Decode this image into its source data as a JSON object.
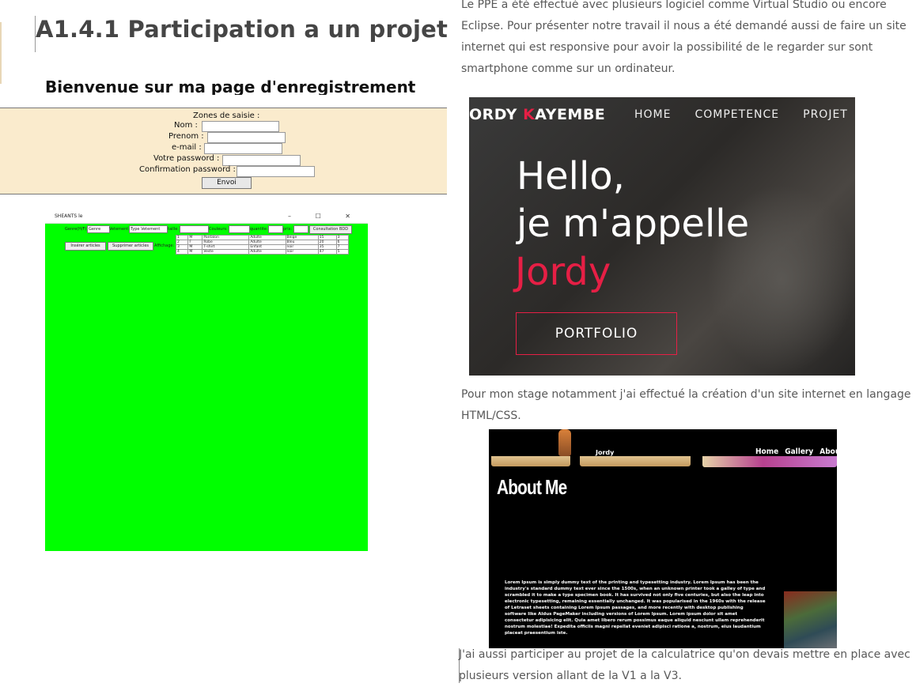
{
  "left": {
    "heading": "A1.4.1 Participation a un projet",
    "registration": {
      "title": "Bienvenue sur ma page d'enregistrement",
      "section_label": "Zones de saisie :",
      "fields": [
        {
          "label": "Nom :"
        },
        {
          "label": "Prenom :"
        },
        {
          "label": "e-mail :"
        },
        {
          "label": "Votre password :"
        },
        {
          "label": "Confirmation password :"
        }
      ],
      "submit_label": "Envoi"
    },
    "java_app": {
      "window_title": "SHEANTS le",
      "controls": "–  ☐  ✕",
      "filters": {
        "genre_label": "Genre(H/F):",
        "genre_value": "Genre",
        "vetement_label": "Vetement:",
        "vetement_value": "Type Vetement",
        "taille_label": "taille:",
        "couleurs_label": "Couleurs:",
        "quantite_label": "quantite:",
        "prix_label": "prix:",
        "consult_button": "Consultation BDD"
      },
      "insert_button": "Insérer articles",
      "delete_button": "Supprimer articles",
      "affichage_label": "Affichage:",
      "table_rows": [
        [
          "1",
          "M",
          "Pantalon",
          "Adulte",
          "Beige",
          "15",
          "3"
        ],
        [
          "2",
          "F",
          "Robe",
          "Adulte",
          "Bleu",
          "20",
          "6"
        ],
        [
          "3",
          "M",
          "T-shirt",
          "Enfant",
          "noir",
          "35",
          "7"
        ],
        [
          "4",
          "M",
          "Veste",
          "Adulte",
          "noir",
          "47",
          "5"
        ]
      ]
    }
  },
  "right": {
    "para1": "Le PPE a été effectué avec plusieurs logiciel comme Virtual Studio ou encore Eclipse. Pour présenter notre travail il nous a été demandé aussi de faire un site internet qui est responsive pour avoir la possibilité de le regarder sur sont smartphone comme sur un ordinateur.",
    "portfolio": {
      "brand_first_rest": "ORDY",
      "brand_first_initial": "J",
      "brand_last_initial": "K",
      "brand_last_rest": "AYEMBE",
      "nav": [
        "HOME",
        "COMPETENCE",
        "PROJET"
      ],
      "hello_line1": "Hello,",
      "hello_line2": "je m'appelle",
      "name": "Jordy",
      "button": "PORTFOLIO"
    },
    "para2": "Pour mon stage notamment j'ai effectué la création d'un site internet en langage HTML/CSS.",
    "aboutme": {
      "brand": "Jordy",
      "nav": [
        "Home",
        "Gallery",
        "About Me"
      ],
      "title": "About Me",
      "body": "Lorem Ipsum is simply dummy text of the printing and typesetting industry. Lorem Ipsum has been the industry's standard dummy text ever since the 1500s, when an unknown printer took a galley of type and scrambled it to make a type specimen book. It has survived not only five centuries, but also the leap into electronic typesetting, remaining essentially unchanged. It was popularised in the 1960s with the release of Letraset sheets containing Lorem Ipsum passages, and more recently with desktop publishing software like Aldus PageMaker including versions of Lorem Ipsum. Lorem ipsum dolor sit amet consectetur adipisicing elit. Quia amet libero rerum possimus eaque aliquid nesciunt ullam reprehenderit nostrum molestiae! Expedita officiis magni repellat eveniet adipisci ratione a, nostrum, eius laudantium placeat praesentium iste."
    },
    "para3": "J'ai aussi participer au projet de la calculatrice qu'on devais mettre en place avec plusieurs version allant de la V1 a la V3."
  }
}
